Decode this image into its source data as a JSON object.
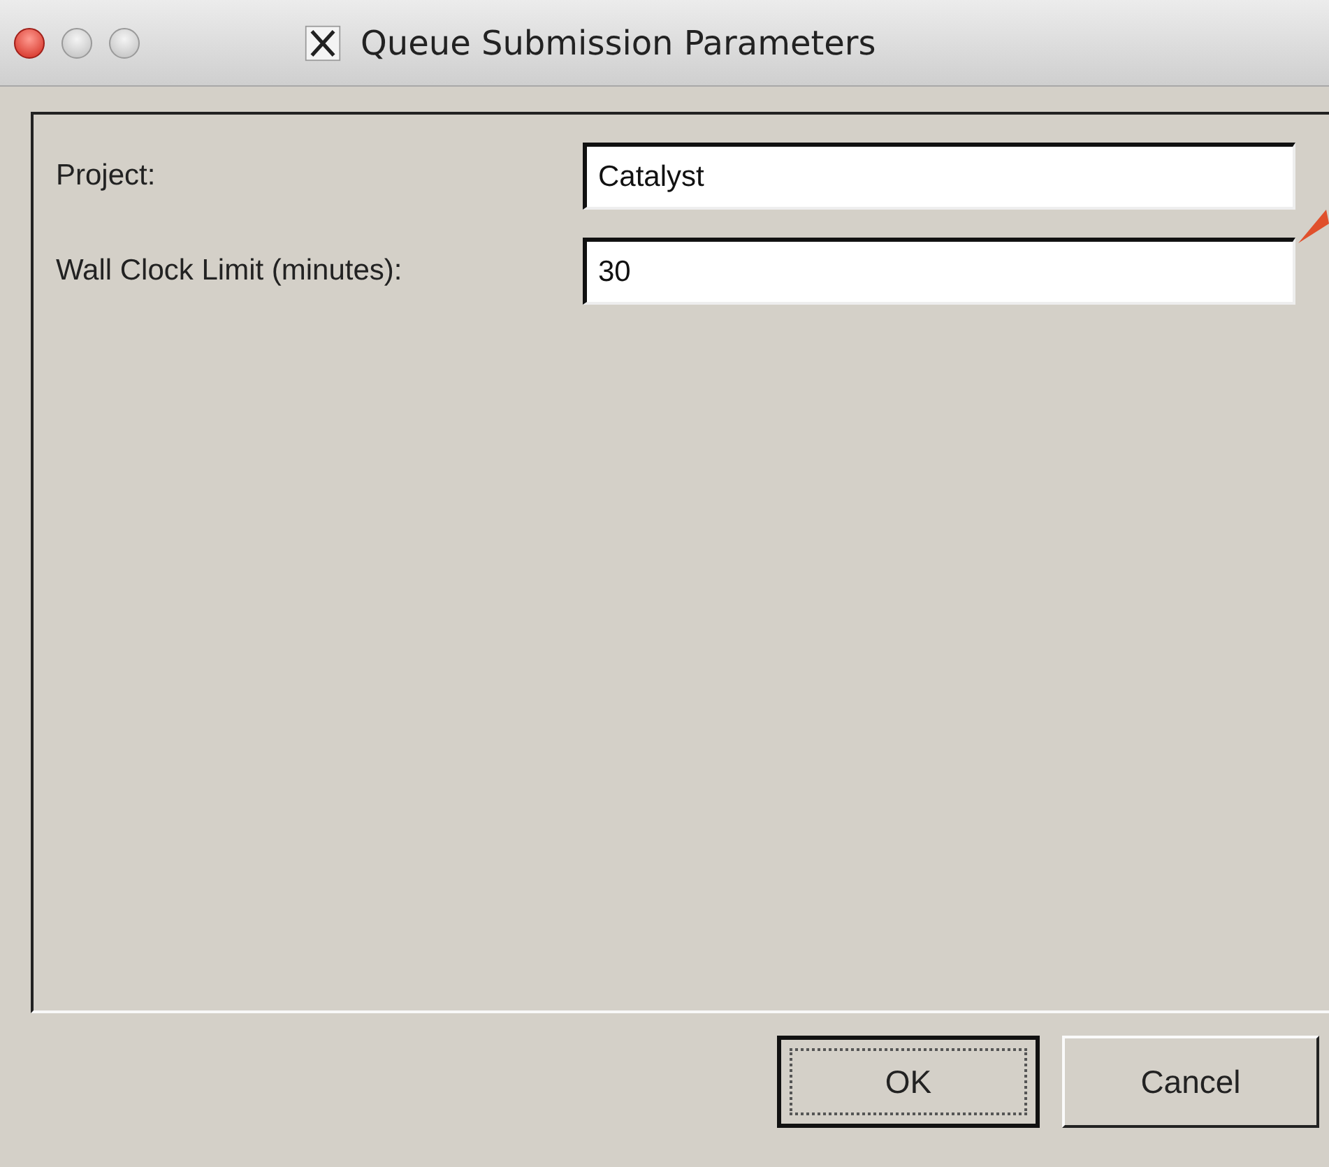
{
  "window": {
    "title": "Queue Submission Parameters"
  },
  "fields": [
    {
      "label": "Project:",
      "value": "Catalyst"
    },
    {
      "label": "Wall Clock Limit (minutes):",
      "value": "30"
    }
  ],
  "buttons": [
    {
      "label": "OK",
      "default": true
    },
    {
      "label": "Cancel",
      "default": false
    }
  ]
}
